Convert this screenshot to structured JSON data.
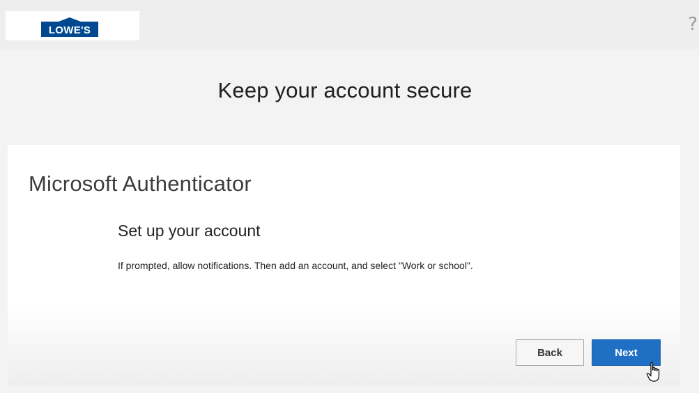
{
  "header": {
    "logo_text": "LOWE'S",
    "help_icon": "?"
  },
  "main": {
    "title": "Keep your account secure"
  },
  "card": {
    "section_title": "Microsoft Authenticator",
    "step_title": "Set up your account",
    "step_text": "If prompted, allow notifications. Then add an account, and select \"Work or school\"."
  },
  "buttons": {
    "back_label": "Back",
    "next_label": "Next"
  },
  "colors": {
    "brand_blue": "#004990",
    "primary_button": "#1f6fc4"
  }
}
